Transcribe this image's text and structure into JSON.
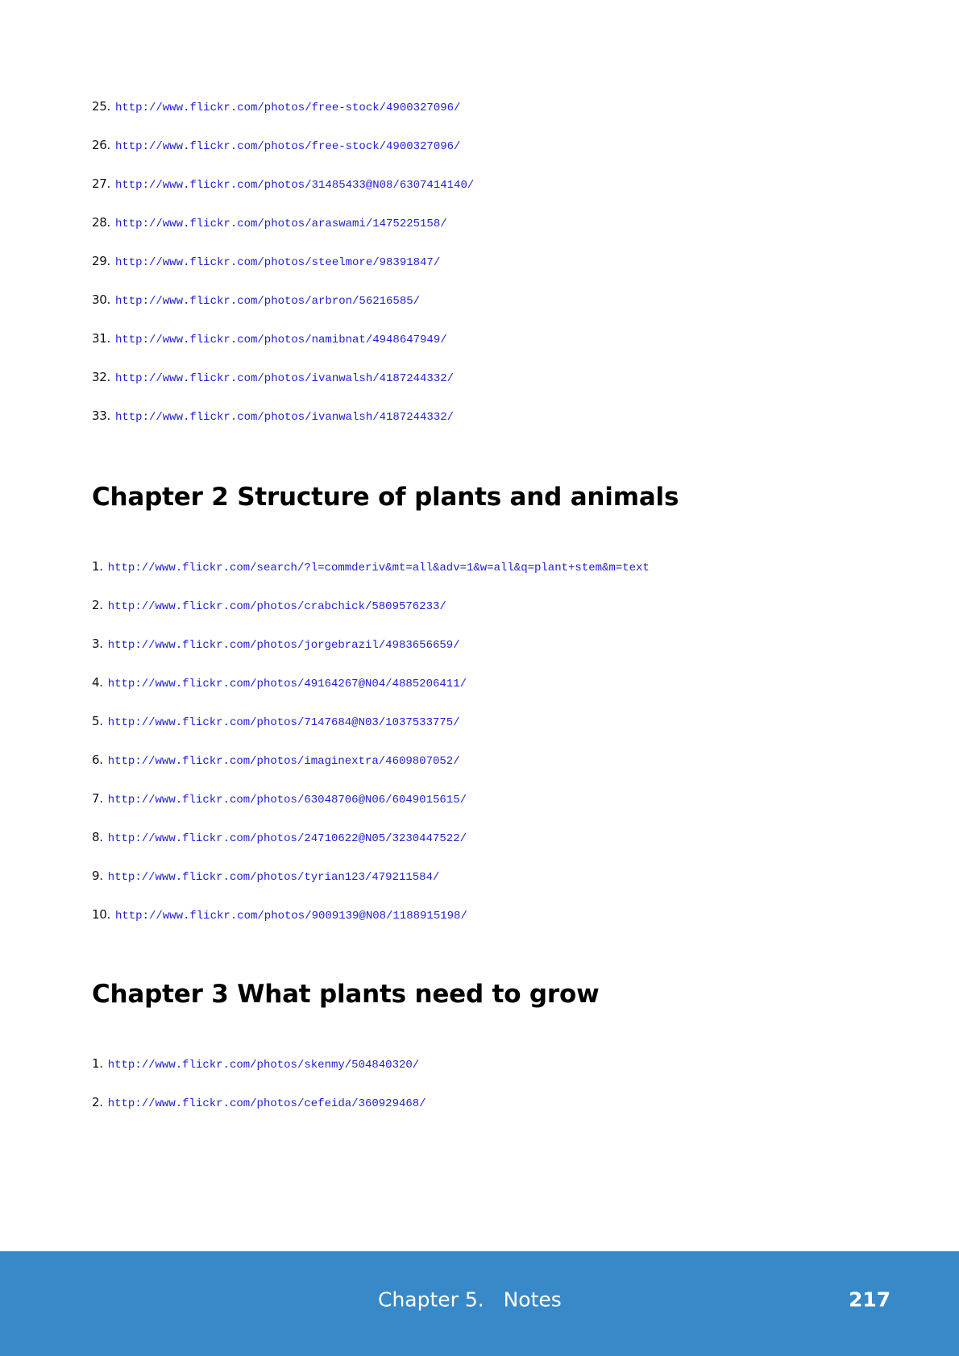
{
  "sections": [
    {
      "heading": null,
      "items": [
        {
          "num": "25.",
          "url": "http://www.flickr.com/photos/free-stock/4900327096/"
        },
        {
          "num": "26.",
          "url": "http://www.flickr.com/photos/free-stock/4900327096/"
        },
        {
          "num": "27.",
          "url": "http://www.flickr.com/photos/31485433@N08/6307414140/"
        },
        {
          "num": "28.",
          "url": "http://www.flickr.com/photos/araswami/1475225158/"
        },
        {
          "num": "29.",
          "url": "http://www.flickr.com/photos/steelmore/98391847/"
        },
        {
          "num": "30.",
          "url": "http://www.flickr.com/photos/arbron/56216585/"
        },
        {
          "num": "31.",
          "url": "http://www.flickr.com/photos/namibnat/4948647949/"
        },
        {
          "num": "32.",
          "url": "http://www.flickr.com/photos/ivanwalsh/4187244332/"
        },
        {
          "num": "33.",
          "url": "http://www.flickr.com/photos/ivanwalsh/4187244332/"
        }
      ]
    },
    {
      "heading": "Chapter 2 Structure of plants and animals",
      "items": [
        {
          "num": "1.",
          "url": "http://www.flickr.com/search/?l=commderiv&mt=all&adv=1&w=all&q=plant+stem&m=text"
        },
        {
          "num": "2.",
          "url": "http://www.flickr.com/photos/crabchick/5809576233/"
        },
        {
          "num": "3.",
          "url": "http://www.flickr.com/photos/jorgebrazil/4983656659/"
        },
        {
          "num": "4.",
          "url": "http://www.flickr.com/photos/49164267@N04/4885206411/"
        },
        {
          "num": "5.",
          "url": "http://www.flickr.com/photos/7147684@N03/1037533775/"
        },
        {
          "num": "6.",
          "url": "http://www.flickr.com/photos/imaginextra/4609807052/"
        },
        {
          "num": "7.",
          "url": "http://www.flickr.com/photos/63048706@N06/6049015615/"
        },
        {
          "num": "8.",
          "url": "http://www.flickr.com/photos/24710622@N05/3230447522/"
        },
        {
          "num": "9.",
          "url": "http://www.flickr.com/photos/tyrian123/479211584/"
        },
        {
          "num": "10.",
          "url": "http://www.flickr.com/photos/9009139@N08/1188915198/"
        }
      ]
    },
    {
      "heading": "Chapter 3 What plants need to grow",
      "items": [
        {
          "num": "1.",
          "url": "http://www.flickr.com/photos/skenmy/504840320/"
        },
        {
          "num": "2.",
          "url": "http://www.flickr.com/photos/cefeida/360929468/"
        }
      ]
    }
  ],
  "footer": {
    "title": "Chapter 5.   Notes",
    "page": "217"
  },
  "colors": {
    "link": "#1f1fd0",
    "footer_bg": "#3889c8"
  }
}
